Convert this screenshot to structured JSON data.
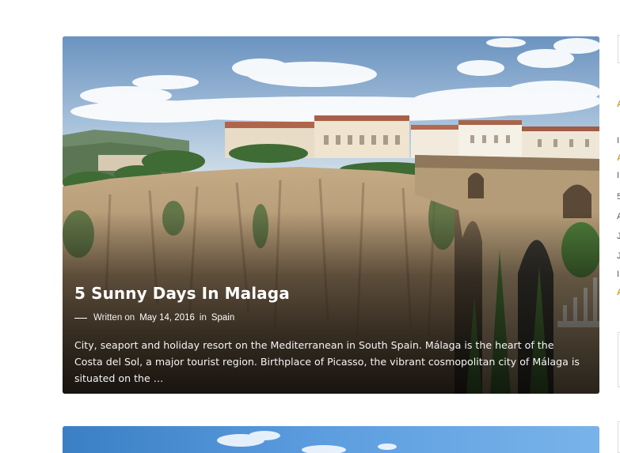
{
  "post": {
    "title": "5 Sunny Days In Malaga",
    "meta": {
      "prefix": "Written on",
      "date": "May 14, 2016",
      "connector": "in",
      "category": "Spain"
    },
    "excerpt": "City, seaport and holiday resort on the Mediterranean in South Spain. Málaga is the heart of the Costa del Sol, a major tourist region. Birthplace of Picasso, the vibrant cosmopolitan city of Málaga is situated on the …"
  },
  "sidebar_fragments": [
    "A",
    "I",
    "A",
    "I",
    "5",
    "A",
    "J",
    "J",
    "I",
    "A"
  ],
  "colors": {
    "accent": "#c8a235",
    "sky": "#9fbcd9",
    "cliff": "#a68c6b",
    "card2_sky": "#5d9ee0"
  }
}
